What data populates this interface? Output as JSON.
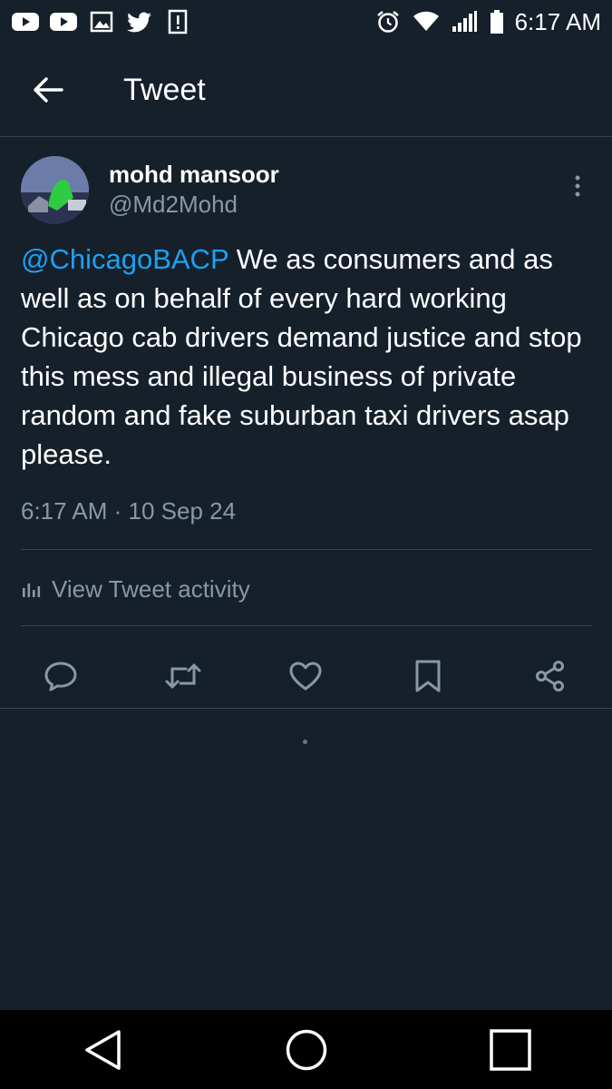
{
  "status_bar": {
    "time": "6:17 AM",
    "left_icons": [
      "youtube-icon",
      "youtube-icon",
      "gallery-icon",
      "twitter-icon",
      "alert-icon"
    ],
    "right_icons": [
      "alarm-icon",
      "wifi-icon",
      "signal-icon",
      "battery-icon"
    ]
  },
  "header": {
    "title": "Tweet",
    "back_icon": "arrow-left-icon"
  },
  "tweet": {
    "author_name": "mohd mansoor",
    "author_handle": "@Md2Mohd",
    "mention": "@ChicagoBACP",
    "body": " We as consumers and as well as on behalf of every hard working Chicago cab drivers demand justice and stop this mess and illegal business of private random and fake suburban taxi drivers asap please.",
    "timestamp": "6:17 AM · 10 Sep 24",
    "activity_label": "View Tweet activity"
  },
  "actions": [
    "reply-icon",
    "retweet-icon",
    "like-icon",
    "bookmark-icon",
    "share-icon"
  ],
  "colors": {
    "background": "#15202b",
    "link": "#1da1f2",
    "secondary_text": "#8899a6",
    "divider": "#38444d"
  },
  "nav_bar": [
    "back-triangle-icon",
    "home-circle-icon",
    "recents-square-icon"
  ]
}
